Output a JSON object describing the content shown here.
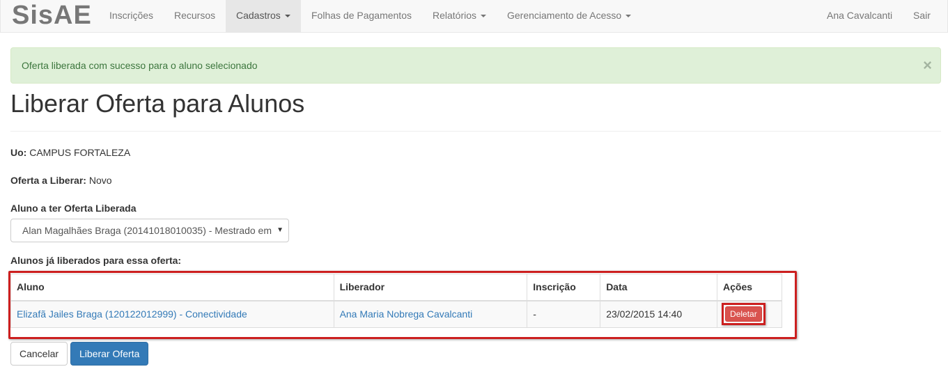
{
  "brand": "SisAE",
  "nav": {
    "items": [
      {
        "label": "Inscrições"
      },
      {
        "label": "Recursos"
      },
      {
        "label": "Cadastros"
      },
      {
        "label": "Folhas de Pagamentos"
      },
      {
        "label": "Relatórios"
      },
      {
        "label": "Gerenciamento de Acesso"
      }
    ],
    "active": "Cadastros",
    "user": "Ana Cavalcanti",
    "logout": "Sair"
  },
  "alert": {
    "message": "Oferta liberada com sucesso para o aluno selecionado",
    "close": "×"
  },
  "page_title": "Liberar Oferta para Alunos",
  "fields": {
    "uo_label": "Uo:",
    "uo_value": "CAMPUS FORTALEZA",
    "oferta_label": "Oferta a Liberar:",
    "oferta_value": "Novo",
    "aluno_label": "Aluno a ter Oferta Liberada",
    "aluno_selected": "Alan Magalhães Braga (20141018010035) - Mestrado em"
  },
  "table": {
    "caption": "Alunos já liberados para essa oferta:",
    "columns": [
      "Aluno",
      "Liberador",
      "Inscrição",
      "Data",
      "Ações"
    ],
    "rows": [
      {
        "aluno": "Elizafã Jailes Braga (120122012999) - Conectividade",
        "liberador": "Ana Maria Nobrega Cavalcanti",
        "inscricao": "-",
        "data": "23/02/2015 14:40",
        "acao": "Deletar"
      }
    ]
  },
  "buttons": {
    "cancel": "Cancelar",
    "submit": "Liberar Oferta"
  },
  "colors": {
    "alert_bg": "#dff0d8",
    "primary": "#337ab7",
    "danger": "#d9534f",
    "highlight": "#cc1f1f"
  }
}
